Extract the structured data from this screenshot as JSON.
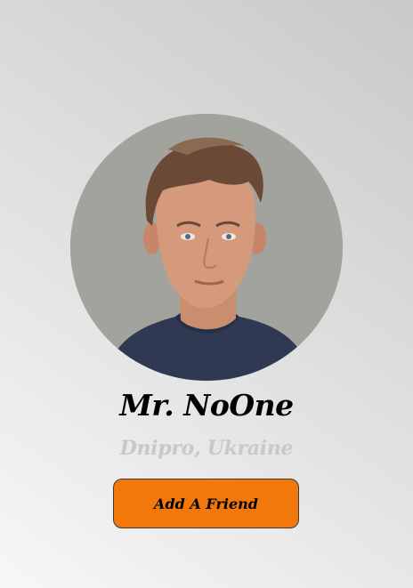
{
  "profile": {
    "name": "Mr. NoOne",
    "location": "Dnipro, Ukraine",
    "add_friend_label": "Add A Friend"
  },
  "colors": {
    "button_bg": "#f2780c",
    "location_text": "#c8c8c8",
    "avatar_bg": "#a3a39e"
  }
}
